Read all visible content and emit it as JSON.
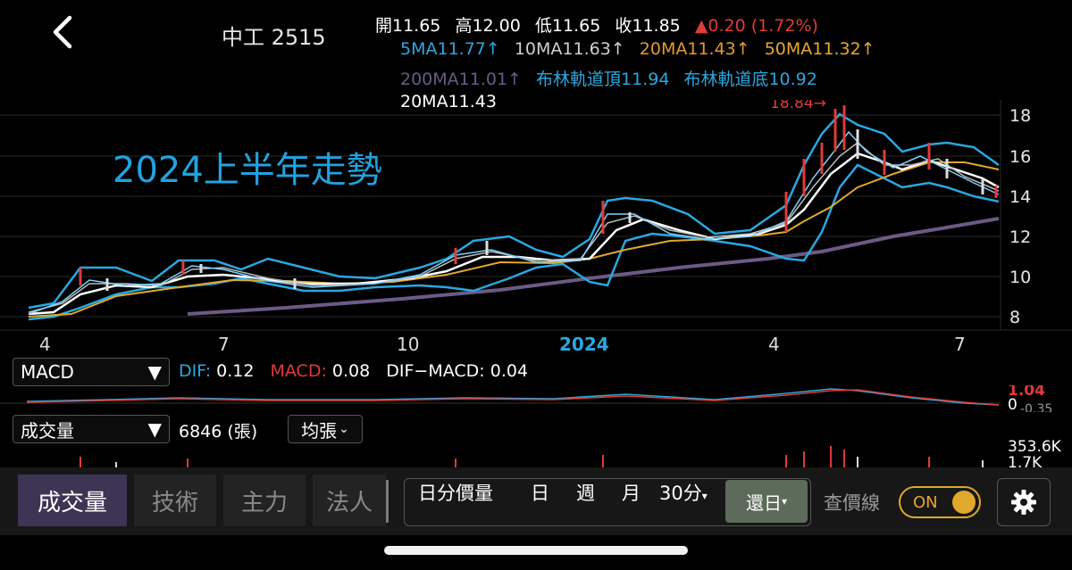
{
  "header": {
    "stock_title": "中工 2515",
    "open": "開11.65",
    "high": "高12.00",
    "low": "低11.65",
    "close": "收11.85",
    "change": "▲0.20 (1.72%)",
    "ma": [
      {
        "label": "5MA11.77↑",
        "color": "#29a8e0"
      },
      {
        "label": "10MA11.63↑",
        "color": "#d0d0d0"
      },
      {
        "label": "20MA11.43↑",
        "color": "#e89a2c"
      },
      {
        "label": "50MA11.32↑",
        "color": "#e8a82c"
      }
    ],
    "ma200": "200MA11.01↑",
    "bollinger_top": "布林軌道頂11.94",
    "bollinger_bottom": "布林軌道底10.92",
    "ma20": "20MA11.43",
    "colors": {
      "up": "#e03a3a",
      "ma200": "#6b5a86",
      "bollinger": "#29a8e0"
    }
  },
  "chart": {
    "max_label": "18.84→",
    "overlay_title": "2024上半年走勢",
    "y_ticks": [
      "18",
      "16",
      "14",
      "12",
      "10",
      "8"
    ],
    "x_ticks": [
      "4",
      "7",
      "10",
      "2024",
      "4",
      "7"
    ]
  },
  "indicator": {
    "selector": "MACD",
    "dif_label": "DIF:",
    "dif_value": "0.12",
    "macd_label": "MACD:",
    "macd_value": "0.08",
    "diff_text": "DIF−MACD: 0.04",
    "right_top": "1.04",
    "right_zero": "0",
    "right_neg": "-0.35"
  },
  "volume": {
    "selector": "成交量",
    "value": "6846 (張)",
    "avg_button": "均張",
    "right_top": "353.6K",
    "right_bottom": "1.7K"
  },
  "bottom": {
    "tabs": [
      "成交量",
      "技術",
      "主力",
      "法人"
    ],
    "periods": [
      "日分價量",
      "日",
      "週",
      "月",
      "30分"
    ],
    "restore": "還日",
    "price_line_label": "查價線",
    "toggle_label": "ON"
  }
}
